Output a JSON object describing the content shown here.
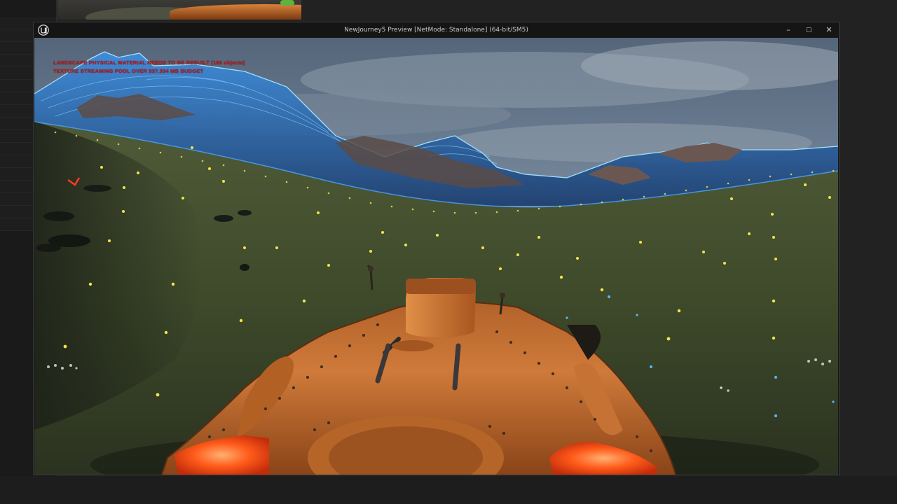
{
  "window": {
    "title": "NewJourney5 Preview [NetMode: Standalone]  (64-bit/SM5)",
    "controls": {
      "minimize": "–",
      "maximize": "☐",
      "close": "✕"
    }
  },
  "viewport": {
    "warnings": [
      "LANDSCAPE PHYSICAL MATERIAL NEEDS TO BE REBUILT (186 objects)",
      "TEXTURE STREAMING POOL OVER 537.334 MB BUDGET"
    ],
    "warning_color": "#c21e1e"
  },
  "icons": {
    "logo": "unreal-engine-logo-icon",
    "minimize": "minimize-icon",
    "maximize": "maximize-icon",
    "close": "close-icon"
  }
}
